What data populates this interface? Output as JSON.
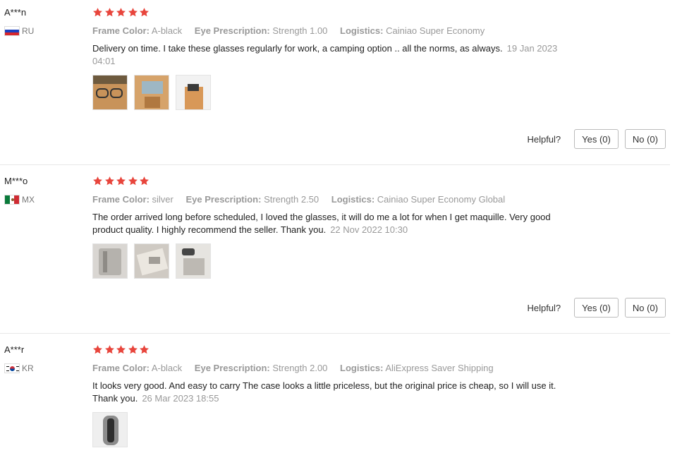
{
  "colors": {
    "star": "#e8453c",
    "muted": "#999999",
    "divider": "#e8e8e8"
  },
  "reviews": [
    {
      "user": "A***n",
      "country": "RU",
      "stars": 5,
      "frame_color_label": "Frame Color:",
      "frame_color": "A-black",
      "prescription_label": "Eye Prescription:",
      "prescription": "Strength 1.00",
      "logistics_label": "Logistics:",
      "logistics": "Cainiao Super Economy",
      "text": "Delivery on time. I take these glasses regularly for work, a camping option .. all the norms, as always.",
      "date": "19 Jan 2023 04:01",
      "helpful_label": "Helpful?",
      "yes_label": "Yes (0)",
      "no_label": "No (0)"
    },
    {
      "user": "M***o",
      "country": "MX",
      "stars": 5,
      "frame_color_label": "Frame Color:",
      "frame_color": "silver",
      "prescription_label": "Eye Prescription:",
      "prescription": "Strength 2.50",
      "logistics_label": "Logistics:",
      "logistics": "Cainiao Super Economy Global",
      "text": "The order arrived long before scheduled, I loved the glasses, it will do me a lot for when I get maquille. Very good product quality. I highly recommend the seller. Thank you.",
      "date": "22 Nov 2022 10:30",
      "helpful_label": "Helpful?",
      "yes_label": "Yes (0)",
      "no_label": "No (0)"
    },
    {
      "user": "A***r",
      "country": "KR",
      "stars": 5,
      "frame_color_label": "Frame Color:",
      "frame_color": "A-black",
      "prescription_label": "Eye Prescription:",
      "prescription": "Strength 2.00",
      "logistics_label": "Logistics:",
      "logistics": "AliExpress Saver Shipping",
      "text": "It looks very good. And easy to carry The case looks a little priceless, but the original price is cheap, so I will use it. Thank you.",
      "date": "26 Mar 2023 18:55"
    }
  ]
}
